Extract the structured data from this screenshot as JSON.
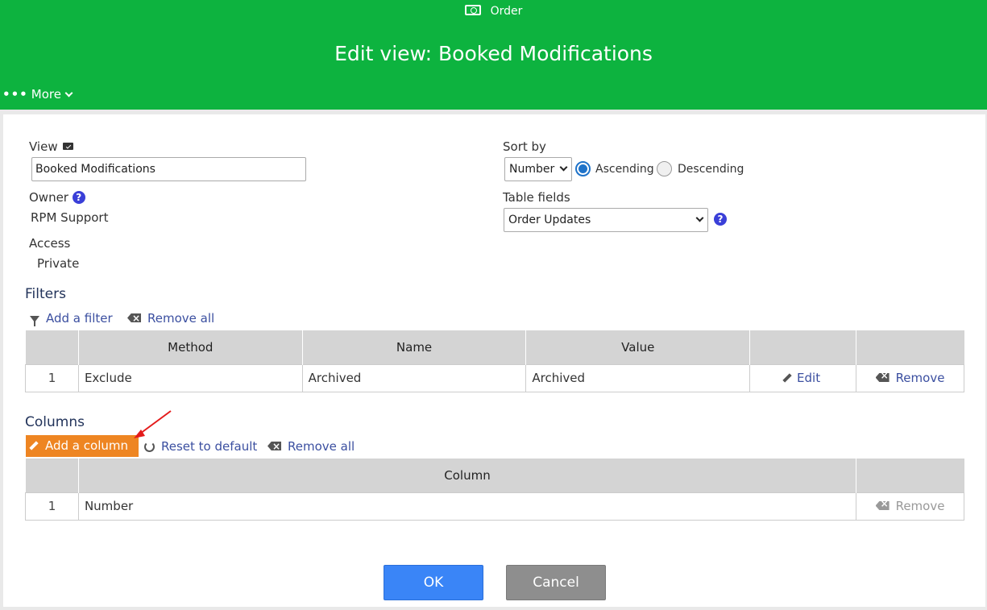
{
  "header": {
    "crumb": "Order",
    "crumb_icon": "money-icon",
    "title": "Edit view: Booked Modifications",
    "more_label": "More",
    "color": "#0db33f"
  },
  "view": {
    "label": "View",
    "value": "Booked Modifications"
  },
  "owner": {
    "label": "Owner",
    "value": "RPM Support"
  },
  "access": {
    "label": "Access",
    "value": "Private"
  },
  "sort": {
    "label": "Sort by",
    "selected": "Number",
    "ascending_label": "Ascending",
    "descending_label": "Descending",
    "direction": "Ascending"
  },
  "table_fields": {
    "label": "Table fields",
    "selected": "Order Updates"
  },
  "filters": {
    "title": "Filters",
    "add_label": "Add a filter",
    "remove_all_label": "Remove all",
    "headers": [
      "",
      "Method",
      "Name",
      "Value",
      "",
      ""
    ],
    "rows": [
      {
        "num": "1",
        "method": "Exclude",
        "name": "Archived",
        "value": "Archived",
        "edit": "Edit",
        "remove": "Remove"
      }
    ]
  },
  "columns": {
    "title": "Columns",
    "add_label": "Add a column",
    "reset_label": "Reset to default",
    "remove_all_label": "Remove all",
    "headers": [
      "",
      "Column",
      ""
    ],
    "rows": [
      {
        "num": "1",
        "column": "Number",
        "remove": "Remove"
      }
    ]
  },
  "buttons": {
    "ok": "OK",
    "cancel": "Cancel"
  },
  "colors": {
    "accent_orange": "#ee8522",
    "ok_blue": "#3a85f7",
    "link": "#3b4fa0"
  }
}
